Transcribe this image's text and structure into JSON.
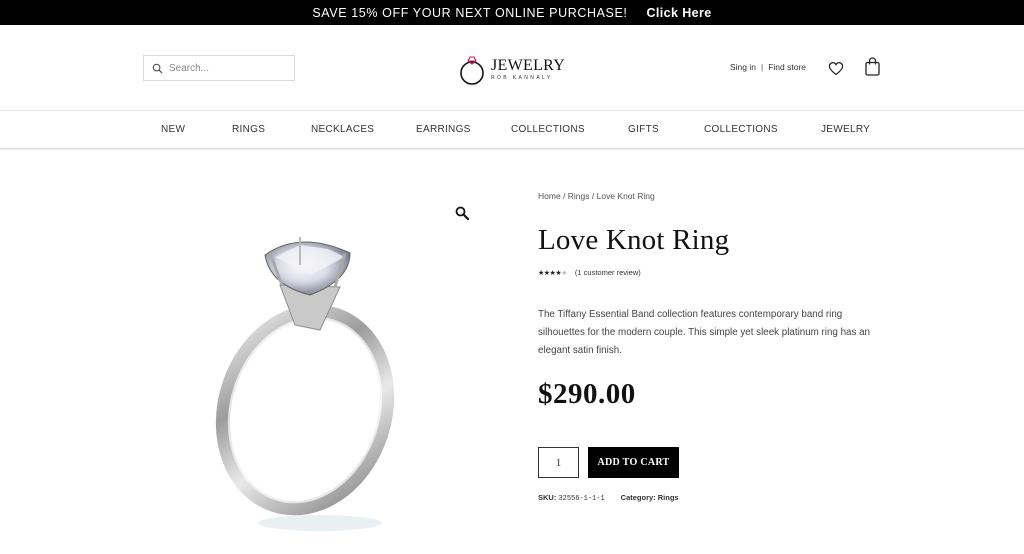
{
  "promo": {
    "text": "SAVE 15% OFF YOUR NEXT ONLINE PURCHASE!",
    "link": "Click Here"
  },
  "header": {
    "search_placeholder": "Search...",
    "logo_title": "JEWELRY",
    "logo_subtitle": "ROB KANNALY",
    "sign_in": "Sing in",
    "separator": "|",
    "find_store": "Find store"
  },
  "nav": {
    "items": [
      {
        "label": "NEW"
      },
      {
        "label": "RINGS"
      },
      {
        "label": "NECKLACES"
      },
      {
        "label": "EARRINGS"
      },
      {
        "label": "COLLECTIONS"
      },
      {
        "label": "GIFTS"
      },
      {
        "label": "COLLECTIONS"
      },
      {
        "label": "JEWELRY"
      }
    ]
  },
  "product": {
    "breadcrumb": {
      "home": "Home",
      "sep": " / ",
      "category": "Rings",
      "current": "Love Knot Ring"
    },
    "title": "Love Knot Ring",
    "rating": {
      "stars": 4,
      "max": 5,
      "review_text": "(1 customer review)"
    },
    "description": "The Tiffany Essential Band collection features contemporary band ring silhouettes for the modern couple. This simple yet sleek platinum ring has an elegant satin finish.",
    "price": "$290.00",
    "quantity": "1",
    "add_to_cart": "ADD TO CART",
    "sku_label": "SKU:",
    "sku": "32556-1-1-1",
    "category_label": "Category:",
    "category": "Rings"
  },
  "colors": {
    "promo_bg": "#000000",
    "button_bg": "#000000",
    "text": "#111111"
  },
  "icons": {
    "search": "search-icon",
    "wishlist": "heart-icon",
    "cart": "shopping-bag-icon",
    "zoom": "magnifier-icon"
  }
}
